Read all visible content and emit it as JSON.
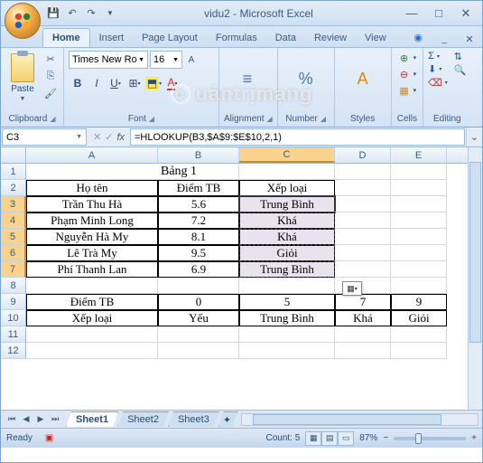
{
  "window": {
    "title": "vidu2 - Microsoft Excel"
  },
  "tabs": {
    "home": "Home",
    "insert": "Insert",
    "pageLayout": "Page Layout",
    "formulas": "Formulas",
    "data": "Data",
    "review": "Review",
    "view": "View"
  },
  "ribbon": {
    "clipboard": {
      "label": "Clipboard",
      "paste": "Paste"
    },
    "font": {
      "label": "Font",
      "name": "Times New Ro",
      "size": "16"
    },
    "alignment": {
      "label": "Alignment"
    },
    "number": {
      "label": "Number"
    },
    "styles": {
      "label": "Styles"
    },
    "cells": {
      "label": "Cells",
      "insert": "",
      "delete": "",
      "format": ""
    },
    "editing": {
      "label": "Editing"
    }
  },
  "formulaBar": {
    "nameBox": "C3",
    "formula": "=HLOOKUP(B3,$A$9:$E$10,2,1)"
  },
  "columns": [
    "A",
    "B",
    "C",
    "D",
    "E"
  ],
  "sheet": {
    "title": "Bảng 1",
    "headers": {
      "hoTen": "Họ tên",
      "diemTB": "Điểm TB",
      "xepLoai": "Xếp loại"
    },
    "rows": [
      {
        "name": "Trần Thu Hà",
        "score": "5.6",
        "rank": "Trung Bình"
      },
      {
        "name": "Phạm Minh Long",
        "score": "7.2",
        "rank": "Khá"
      },
      {
        "name": "Nguyễn Hà My",
        "score": "8.1",
        "rank": "Khá"
      },
      {
        "name": "Lê Trà My",
        "score": "9.5",
        "rank": "Giỏi"
      },
      {
        "name": "Phí Thanh Lan",
        "score": "6.9",
        "rank": "Trung Bình"
      }
    ],
    "lookup": {
      "r1": {
        "label": "Điểm TB",
        "v0": "0",
        "v1": "5",
        "v2": "7",
        "v3": "9"
      },
      "r2": {
        "label": "Xếp loại",
        "v0": "Yếu",
        "v1": "Trung Bình",
        "v2": "Khá",
        "v3": "Giỏi"
      }
    }
  },
  "sheetTabs": {
    "s1": "Sheet1",
    "s2": "Sheet2",
    "s3": "Sheet3"
  },
  "status": {
    "mode": "Ready",
    "count": "Count: 5",
    "zoom": "87%"
  },
  "watermark": "uảntrịmạng"
}
